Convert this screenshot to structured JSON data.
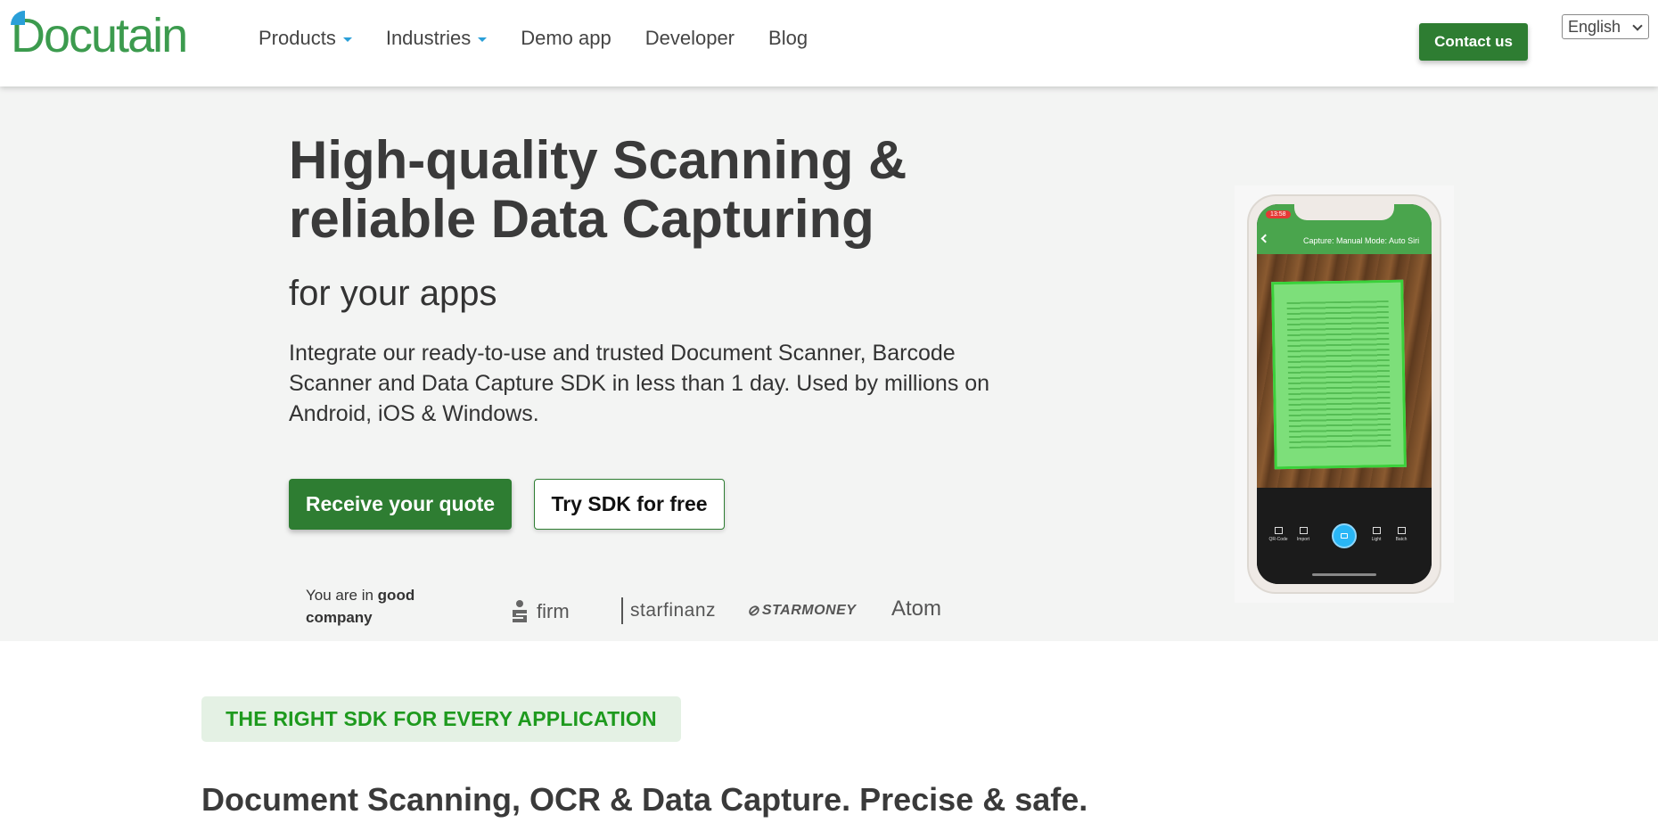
{
  "header": {
    "logo_text": "Docutain",
    "nav": [
      {
        "label": "Products",
        "has_dropdown": true
      },
      {
        "label": "Industries",
        "has_dropdown": true
      },
      {
        "label": "Demo app",
        "has_dropdown": false
      },
      {
        "label": "Developer",
        "has_dropdown": false
      },
      {
        "label": "Blog",
        "has_dropdown": false
      }
    ],
    "contact_label": "Contact us",
    "language": "English"
  },
  "hero": {
    "title_line1": "High-quality Scanning &",
    "title_line2": "reliable Data Capturing",
    "subtitle": "for your apps",
    "description": "Integrate our ready-to-use and trusted Document Scanner, Barcode Scanner and Data Capture SDK in less than 1 day. Used by millions on Android, iOS & Windows.",
    "quote_button": "Receive your quote",
    "try_button": "Try SDK for free",
    "company_prefix": "You are in ",
    "company_bold": "good company",
    "partners": [
      "firm",
      "starfinanz",
      "STARMONEY",
      "Atom"
    ]
  },
  "phone": {
    "time": "13:58",
    "toolbar_text": "Capture: Manual   Mode: Auto   Siri",
    "tools": [
      "QR-Code",
      "Import",
      "Light",
      "Batch"
    ]
  },
  "section": {
    "tag": "THE RIGHT SDK FOR EVERY APPLICATION",
    "title": "Document Scanning, OCR & Data Capture. Precise & safe."
  },
  "colors": {
    "brand_green": "#2e7d32",
    "logo_green": "#3c9b4e",
    "logo_blue": "#2a9fd8",
    "hero_bg": "#f3f4f3",
    "tag_bg": "#e4f1e4",
    "tag_text": "#1e9a1e"
  }
}
